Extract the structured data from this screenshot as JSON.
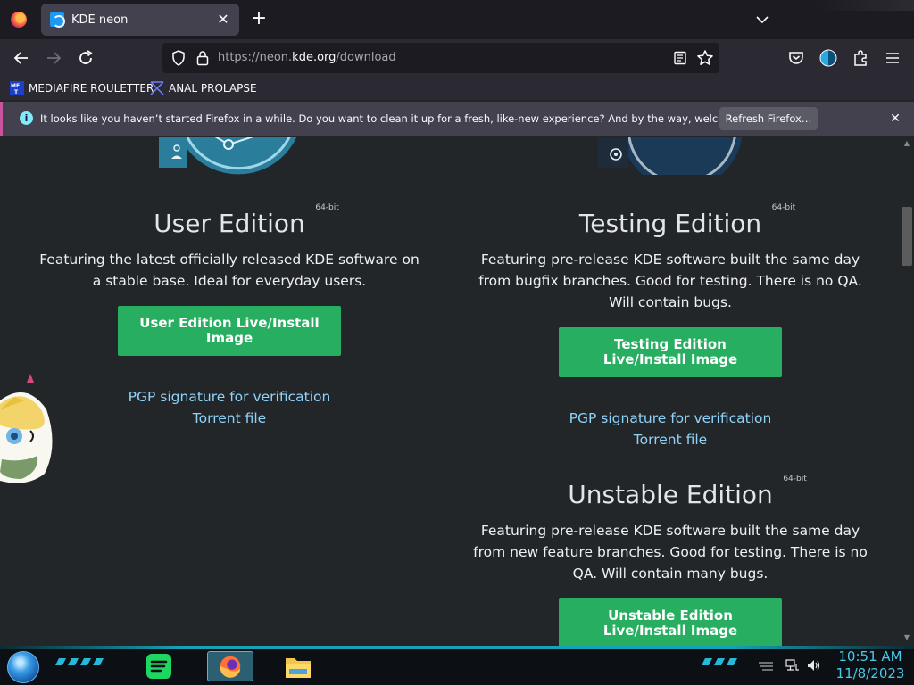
{
  "browser": {
    "tab": {
      "title": "KDE neon"
    },
    "url": {
      "scheme": "https://neon.",
      "host": "kde.org",
      "path": "/download"
    },
    "bookmarks": [
      {
        "label": "MEDIAFIRE ROULETTER"
      },
      {
        "label": "ANAL PROLAPSE"
      }
    ],
    "notification": {
      "message": "It looks like you haven’t started Firefox in a while. Do you want to clean it up for a fresh, like-new experience? And by the way, welcome back!",
      "button": "Refresh Firefox…"
    }
  },
  "page": {
    "editions": [
      {
        "title": "User Edition",
        "bits": "64-bit",
        "description": "Featuring the latest officially released KDE software on a stable base. Ideal for everyday users.",
        "download_label": "User Edition Live/Install Image",
        "pgp_label": "PGP signature for verification",
        "torrent_label": "Torrent file"
      },
      {
        "title": "Testing Edition",
        "bits": "64-bit",
        "description": "Featuring pre-release KDE software built the same day from bugfix branches. Good for testing. There is no QA. Will contain bugs.",
        "download_label": "Testing Edition Live/Install Image",
        "pgp_label": "PGP signature for verification",
        "torrent_label": "Torrent file"
      },
      {
        "title": "Unstable Edition",
        "bits": "64-bit",
        "description": "Featuring pre-release KDE software built the same day from new feature branches. Good for testing. There is no QA. Will contain many bugs.",
        "download_label": "Unstable Edition Live/Install Image"
      }
    ]
  },
  "taskbar": {
    "time": "10:51 AM",
    "date": "11/8/2023"
  },
  "colors": {
    "accent_green": "#27ae60",
    "link_blue": "#8fd2f8",
    "page_bg": "#232629",
    "clock_cyan": "#48c9e8"
  }
}
